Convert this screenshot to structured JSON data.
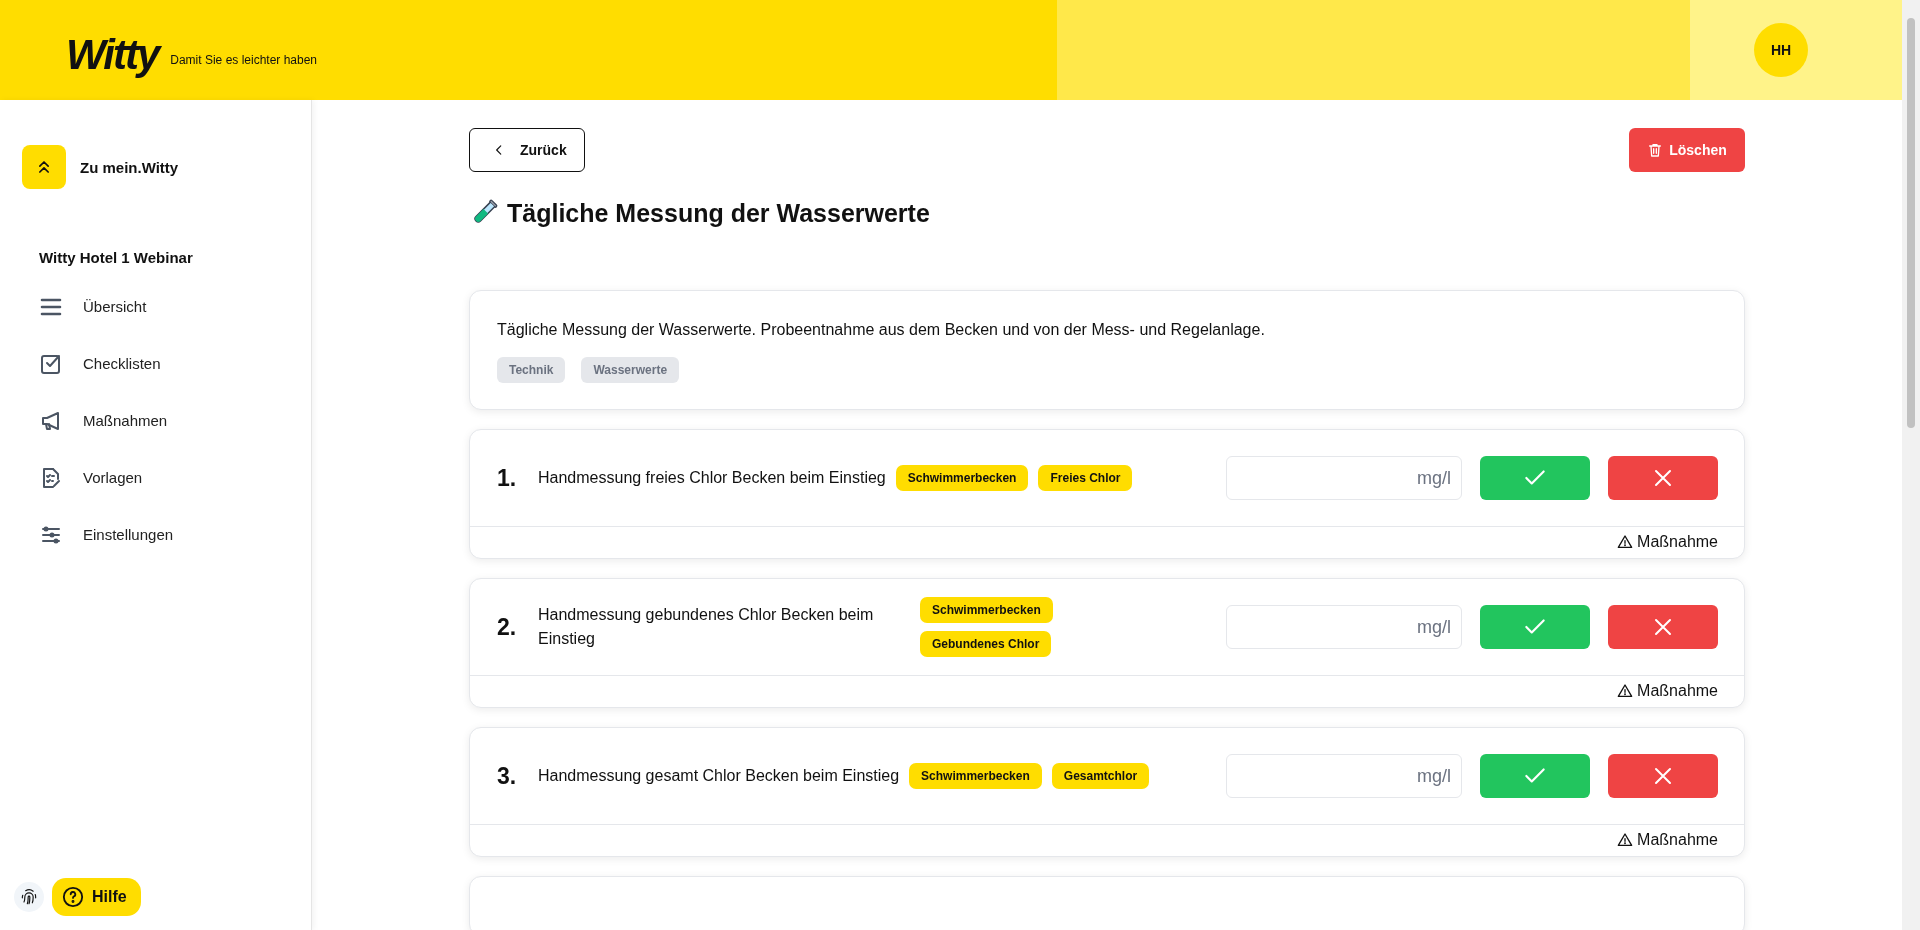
{
  "header": {
    "logo": "Witty",
    "tagline": "Damit Sie es leichter haben",
    "avatar": "HH"
  },
  "sidebar": {
    "back_link": "Zu mein.Witty",
    "section_title": "Witty Hotel 1 Webinar",
    "items": [
      {
        "label": "Übersicht"
      },
      {
        "label": "Checklisten"
      },
      {
        "label": "Maßnahmen"
      },
      {
        "label": "Vorlagen"
      },
      {
        "label": "Einstellungen"
      }
    ],
    "help": "Hilfe"
  },
  "toolbar": {
    "back": "Zurück",
    "delete": "Löschen"
  },
  "title": "Tägliche Messung der Wasserwerte",
  "description": {
    "text": "Tägliche Messung der Wasserwerte. Probeentnahme aus dem Becken und von der Mess- und Regelanlage.",
    "tags": [
      "Technik",
      "Wasserwerte"
    ]
  },
  "items": [
    {
      "number": "1.",
      "title": "Handmessung freies Chlor Becken beim Einstieg",
      "tags": [
        "Schwimmerbecken",
        "Freies Chlor"
      ],
      "unit": "mg/l",
      "action": "Maßnahme"
    },
    {
      "number": "2.",
      "title": "Handmessung gebundenes Chlor Becken beim Einstieg",
      "tags": [
        "Schwimmerbecken",
        "Gebundenes Chlor"
      ],
      "unit": "mg/l",
      "action": "Maßnahme"
    },
    {
      "number": "3.",
      "title": "Handmessung gesamt Chlor Becken beim Einstieg",
      "tags": [
        "Schwimmerbecken",
        "Gesamtchlor"
      ],
      "unit": "mg/l",
      "action": "Maßnahme"
    }
  ]
}
